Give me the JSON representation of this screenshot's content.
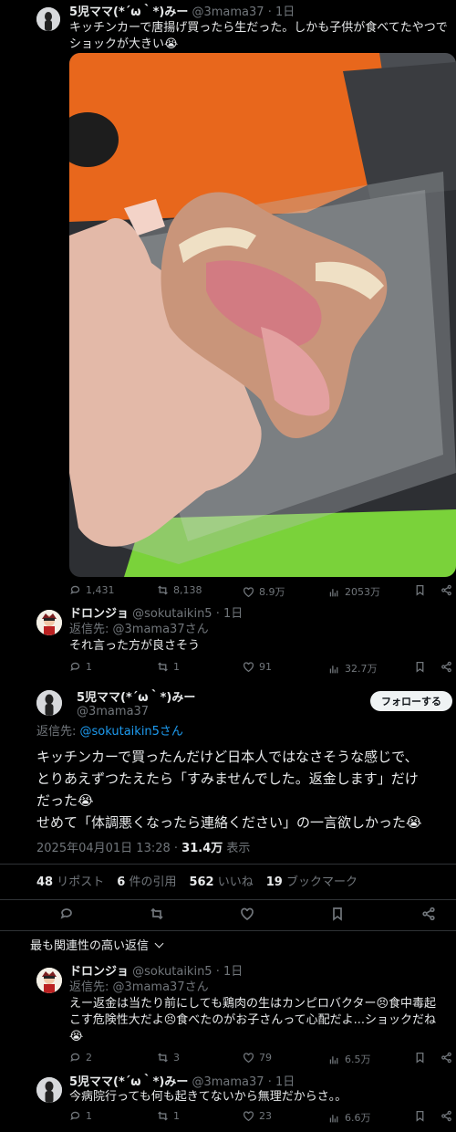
{
  "tweet1": {
    "display_name": "5児ママ(*´ω｀*)みー",
    "handle": "@3mama37",
    "time": "· 1日",
    "text": "キッチンカーで唐揚げ買ったら生だった。しかも子供が食べてたやつでショックが大きい😭",
    "stats": {
      "replies": "1,431",
      "retweets": "8,138",
      "likes": "8.9万",
      "views": "2053万"
    }
  },
  "reply1": {
    "display_name": "ドロンジョ",
    "handle": "@sokutaikin5",
    "time": "· 1日",
    "replying_to": "返信先: @3mama37さん",
    "text": "それ言った方が良さそう",
    "stats": {
      "replies": "1",
      "retweets": "1",
      "likes": "91",
      "views": "32.7万"
    }
  },
  "main": {
    "display_name": "5児ママ(*´ω｀*)みー",
    "handle": "@3mama37",
    "follow_label": "フォローする",
    "replying_prefix": "返信先: ",
    "replying_handle": "@sokutaikin5さん",
    "line1": "キッチンカーで買ったんだけど日本人ではなさそうな感じで、",
    "line2": "とりあえずつたえたら「すみませんでした。返金します」だけ",
    "line3": "だった😭",
    "line4": "せめて「体調悪くなったら連絡ください」の一言欲しかった😭",
    "date": "2025年04月01日 13:28",
    "views_value": "31.4万",
    "views_label": " 表示",
    "counts": [
      {
        "num": "48",
        "label": "リポスト"
      },
      {
        "num": "6",
        "label": "件の引用"
      },
      {
        "num": "562",
        "label": "いいね"
      },
      {
        "num": "19",
        "label": "ブックマーク"
      }
    ]
  },
  "sort_label": "最も関連性の高い返信",
  "reply2": {
    "display_name": "ドロンジョ",
    "handle": "@sokutaikin5",
    "time": "· 1日",
    "replying_to": "返信先: @3mama37さん",
    "line1": "えー返金は当たり前にしても鶏肉の生はカンピロバクター😣食中毒起",
    "line2": "こす危険性大だよ😣食べたのがお子さんって心配だよ...ショックだね",
    "line3": "😭",
    "stats": {
      "replies": "2",
      "retweets": "3",
      "likes": "79",
      "views": "6.5万"
    }
  },
  "reply3": {
    "display_name": "5児ママ(*´ω｀*)みー",
    "handle": "@3mama37",
    "time": "· 1日",
    "text": "今病院行っても何も起きてないから無理だからさ。。",
    "stats": {
      "replies": "1",
      "retweets": "1",
      "likes": "23",
      "views": "6.6万"
    }
  }
}
